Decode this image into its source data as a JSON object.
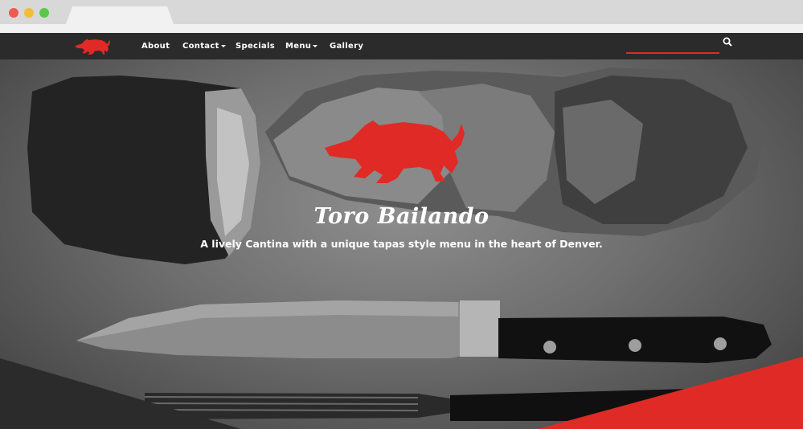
{
  "browser": {
    "window_buttons": [
      "close",
      "minimize",
      "maximize"
    ]
  },
  "nav": {
    "logo_icon": "bull-logo-icon",
    "items": [
      {
        "label": "About",
        "has_dropdown": false
      },
      {
        "label": "Contact",
        "has_dropdown": true
      },
      {
        "label": "Specials",
        "has_dropdown": false
      },
      {
        "label": "Menu",
        "has_dropdown": true
      },
      {
        "label": "Gallery",
        "has_dropdown": false
      }
    ],
    "search_icon": "search-icon"
  },
  "hero": {
    "title": "Toro Bailando",
    "subtitle": "A lively Cantina with a unique tapas style menu in the heart of Denver."
  },
  "colors": {
    "accent": "#e02a26",
    "nav_bg": "#2b2b2b",
    "text": "#ffffff"
  }
}
